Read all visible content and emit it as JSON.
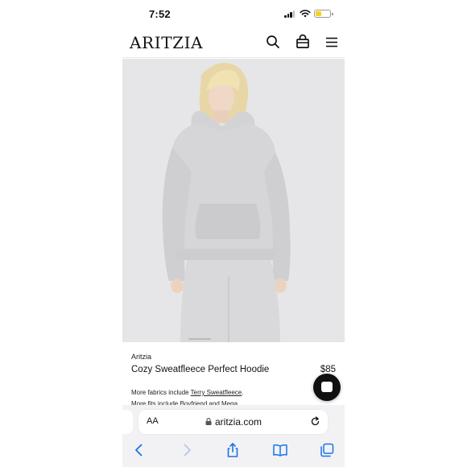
{
  "status_bar": {
    "time": "7:52",
    "battery_color": "#f5d31a"
  },
  "header": {
    "logo": "ARITZIA",
    "icons": [
      "search-icon",
      "bag-icon",
      "menu-icon"
    ]
  },
  "product": {
    "brand": "Aritzia",
    "name": "Cozy Sweatfleece Perfect Hoodie",
    "price": "$85",
    "fabrics_prefix": "More fabrics include ",
    "fabrics_link": "Terry Sweatfleece",
    "fabrics_suffix": ".",
    "fits_note": "More fits include Boyfriend and Mega"
  },
  "browser": {
    "text_size_label": "AA",
    "url": "aritzia.com",
    "toolbar_icons": [
      "back-icon",
      "forward-icon",
      "share-icon",
      "bookmarks-icon",
      "tabs-icon"
    ],
    "accent_color": "#1a73e8"
  }
}
